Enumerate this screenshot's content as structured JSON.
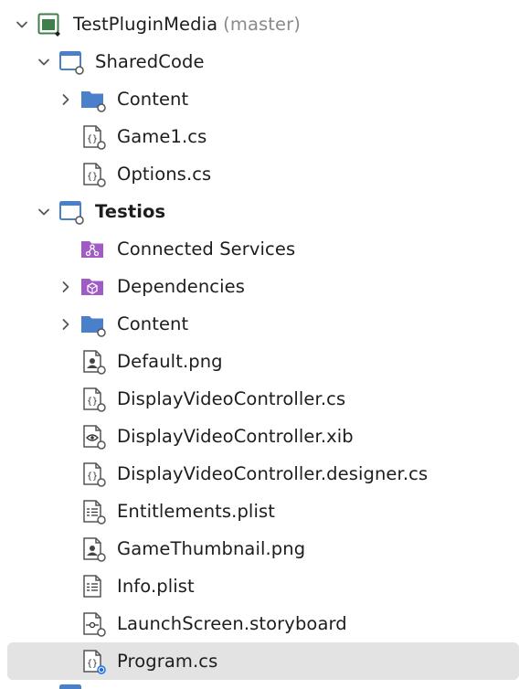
{
  "solution": {
    "name": "TestPluginMedia",
    "branch": "(master)"
  },
  "projects": {
    "shared": {
      "name": "SharedCode",
      "items": {
        "content": "Content",
        "game1": "Game1.cs",
        "options": "Options.cs"
      }
    },
    "testios": {
      "name": "Testios",
      "items": {
        "connected_services": "Connected Services",
        "dependencies": "Dependencies",
        "content": "Content",
        "default_png": "Default.png",
        "display_cs": "DisplayVideoController.cs",
        "display_xib": "DisplayVideoController.xib",
        "display_designer": "DisplayVideoController.designer.cs",
        "entitlements": "Entitlements.plist",
        "thumbnail": "GameThumbnail.png",
        "info": "Info.plist",
        "launch": "LaunchScreen.storyboard",
        "program": "Program.cs"
      }
    }
  },
  "colors": {
    "folder_blue": "#4a7fc9",
    "services_purple": "#a05cc4",
    "selection_bg": "#e3e3e3",
    "status_blue": "#1f6fe5"
  }
}
